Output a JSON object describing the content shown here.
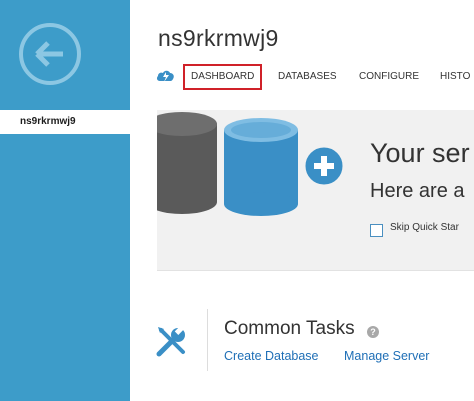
{
  "sidebar": {
    "back_icon": "arrow-left-icon",
    "selected_item": "ns9rkrmwj9"
  },
  "header": {
    "title": "ns9rkrmwj9",
    "quickstart_icon": "cloud-lightning-icon",
    "tabs": [
      {
        "label": "DASHBOARD",
        "active": true
      },
      {
        "label": "DATABASES",
        "active": false
      },
      {
        "label": "CONFIGURE",
        "active": false
      },
      {
        "label": "HISTO",
        "active": false
      }
    ]
  },
  "quickstart": {
    "title": "Your ser",
    "subtitle": "Here are a",
    "skip_label": "Skip Quick Star",
    "skip_checked": false
  },
  "tasks": {
    "title": "Common Tasks",
    "help_icon": "?",
    "links": [
      "Create Database",
      "Manage Server"
    ]
  },
  "colors": {
    "sidebar": "#3d9cc9",
    "accent_blue": "#3a8fc6",
    "dark_cylinder": "#5a5a5a",
    "link": "#1f6fb6",
    "highlight_red": "#d02129"
  }
}
